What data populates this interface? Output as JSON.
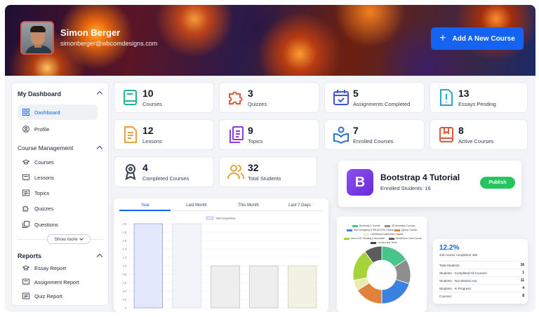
{
  "profile": {
    "name": "Simon Berger",
    "email": "simonberger@wbcomdesigns.com"
  },
  "header": {
    "add_course_label": "Add A New Course"
  },
  "sidebar": {
    "dashboard_heading": "My Dashboard",
    "dashboard_items": [
      {
        "label": "Dashboard",
        "icon": "grid-icon",
        "active": true
      },
      {
        "label": "Profile",
        "icon": "user-circle-icon",
        "active": false
      }
    ],
    "course_heading": "Course Management",
    "course_items": [
      {
        "label": "Courses",
        "icon": "graduation-cap-icon"
      },
      {
        "label": "Lessons",
        "icon": "slides-icon"
      },
      {
        "label": "Topics",
        "icon": "topics-icon"
      },
      {
        "label": "Quizzes",
        "icon": "puzzle-icon"
      },
      {
        "label": "Questions",
        "icon": "copy-icon"
      }
    ],
    "show_more_label": "Show more",
    "reports_heading": "Reports",
    "report_items": [
      {
        "label": "Essay Report",
        "icon": "graduation-cap-icon"
      },
      {
        "label": "Assignment Report",
        "icon": "slides-icon"
      },
      {
        "label": "Quiz Report",
        "icon": "topics-icon"
      }
    ]
  },
  "stats": [
    {
      "value": "10",
      "label": "Courses",
      "icon": "book-icon",
      "color": "#22b39a"
    },
    {
      "value": "3",
      "label": "Quizzes",
      "icon": "puzzle-icon",
      "color": "#e0553d"
    },
    {
      "value": "5",
      "label": "Assignments Completed",
      "icon": "calendar-check-icon",
      "color": "#4055d8"
    },
    {
      "value": "13",
      "label": "Essays Pending",
      "icon": "alert-doc-icon",
      "color": "#2aa9c7"
    },
    {
      "value": "12",
      "label": "Lessons",
      "icon": "document-icon",
      "color": "#e5a33d"
    },
    {
      "value": "9",
      "label": "Topics",
      "icon": "files-icon",
      "color": "#8b3fd9"
    },
    {
      "value": "7",
      "label": "Enrolled Courses",
      "icon": "reader-icon",
      "color": "#2d72c9"
    },
    {
      "value": "8",
      "label": "Active Courses",
      "icon": "book-bookmark-icon",
      "color": "#e05a3a"
    },
    {
      "value": "4",
      "label": "Completed Courses",
      "icon": "certificate-icon",
      "color": "#374151"
    },
    {
      "value": "32",
      "label": "Total Students",
      "icon": "users-icon",
      "color": "#e5a33d"
    }
  ],
  "tutorial": {
    "title": "Bootstrap 4 Tutorial",
    "subtitle": "Enrolled Students: 16",
    "badge": "B",
    "publish_label": "Publish"
  },
  "activity": {
    "tabs": [
      "Year",
      "Last Month",
      "This Month",
      "Last 7 Days"
    ],
    "active_tab": 0,
    "legend": "Total Completions"
  },
  "completion": {
    "percent": "12.2%",
    "caption": "440 course completion rate",
    "rows": [
      {
        "label": "Total Students:",
        "value": "16"
      },
      {
        "label": "Students - Completed All Courses:",
        "value": "1"
      },
      {
        "label": "Students - Not Started Any:",
        "value": "11"
      },
      {
        "label": "Students - In Progress:",
        "value": "4"
      },
      {
        "label": "Courses:",
        "value": "8"
      }
    ]
  },
  "chart_data": [
    {
      "type": "bar",
      "categories": [
        "",
        "",
        "",
        "",
        ""
      ],
      "series": [
        {
          "name": "Total Completions",
          "values": [
            2.0,
            2.0,
            1.0,
            1.0,
            1.0
          ]
        }
      ],
      "ylim": [
        0,
        2.0
      ],
      "yticks": [
        "0",
        "0.2",
        "0.4",
        "0.6",
        "0.8",
        "1.0",
        "1.2",
        "1.4",
        "1.6",
        "1.8",
        "2.0"
      ],
      "colors": [
        "#e4e8fb",
        "#f3f4f9",
        "#eeeeee",
        "#eeeeee",
        "#f1f2e4"
      ],
      "borders": [
        "#8890e6",
        "#d4d7e6",
        "#b6b6b6",
        "#b6b6b6",
        "#cfd0a6"
      ],
      "grid": true
    },
    {
      "type": "pie",
      "labels": [
        "Bootstrap 4 Tutorial",
        "3D Animation Courses",
        "Web Designing HTML5/CSS3 Tutorial",
        "jQuery Tutorial",
        "LearnDash Dashboard Tutorial",
        "Intro to 3D Shading & Animation",
        "WordPress Crea Course",
        "Let Dev and Think"
      ],
      "values": [
        16,
        14,
        20,
        16,
        6,
        18,
        10,
        0
      ],
      "colors": [
        "#48c58b",
        "#8e8e8e",
        "#3b82e0",
        "#e0823a",
        "#e8ecb0",
        "#a4d43a",
        "#5c5c5c",
        "#444444"
      ],
      "donut": true
    }
  ]
}
